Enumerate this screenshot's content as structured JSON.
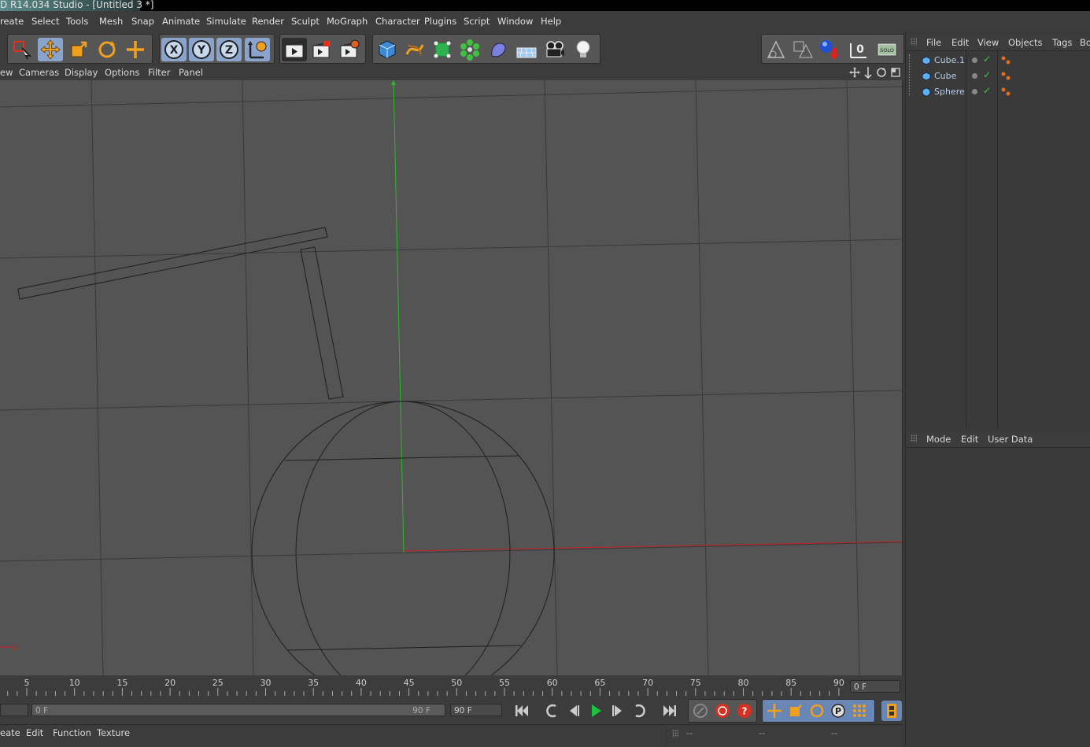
{
  "window": {
    "title": "D R14.034 Studio - [Untitled 3 *]"
  },
  "menubar": [
    "reate",
    "Select",
    "Tools",
    "Mesh",
    "Snap",
    "Animate",
    "Simulate",
    "Render",
    "Sculpt",
    "MoGraph",
    "Character",
    "Plugins",
    "Script",
    "Window",
    "Help"
  ],
  "toolbar": {
    "tools": [
      {
        "name": "live-selection-icon",
        "selected": false
      },
      {
        "name": "move-icon",
        "selected": true
      },
      {
        "name": "scale-icon",
        "selected": false
      },
      {
        "name": "rotate-icon",
        "selected": false
      },
      {
        "name": "recent-tool-icon",
        "selected": false
      }
    ],
    "axes": [
      "X",
      "Y",
      "Z"
    ],
    "coord_system_icon": "world-coordinate-icon",
    "render": [
      "render-view-icon",
      "render-picture-viewer-icon",
      "render-settings-icon"
    ],
    "create": [
      "cube-icon",
      "spline-icon",
      "nurbs-icon",
      "array-icon",
      "deformer-icon",
      "floor-icon",
      "camera-icon",
      "light-icon"
    ],
    "right": [
      "scene-icon",
      "material-icon",
      "sphere-drop-icon",
      "layer-icon",
      "solo-icon"
    ],
    "solo_label": "SOLO"
  },
  "viewport_menu": [
    "ew",
    "Cameras",
    "Display",
    "Options",
    "Filter",
    "Panel"
  ],
  "viewport": {
    "axis_label": "X",
    "colors": {
      "y_axis": "#2fb82f",
      "x_axis": "#c82020",
      "grid": "#3a3a3a",
      "bg": "#545454"
    }
  },
  "timeline": {
    "ticks": [
      "5",
      "10",
      "15",
      "20",
      "25",
      "30",
      "35",
      "40",
      "45",
      "50",
      "55",
      "60",
      "65",
      "70",
      "75",
      "80",
      "85",
      "90"
    ],
    "current_frame": "0 F"
  },
  "transport": {
    "range_start": "0 F",
    "range_end": "90 F",
    "end_frame": "90 F"
  },
  "material_menu": [
    "eate",
    "Edit",
    "Function",
    "Texture"
  ],
  "coord_values": [
    "--",
    "--",
    "--"
  ],
  "object_manager": {
    "menu": [
      "File",
      "Edit",
      "View",
      "Objects",
      "Tags",
      "Bo"
    ],
    "objects": [
      {
        "name": "Cube.1",
        "type": "cube"
      },
      {
        "name": "Cube",
        "type": "cube"
      },
      {
        "name": "Sphere",
        "type": "sphere"
      }
    ]
  },
  "attribute_manager": {
    "menu": [
      "Mode",
      "Edit",
      "User Data"
    ]
  }
}
